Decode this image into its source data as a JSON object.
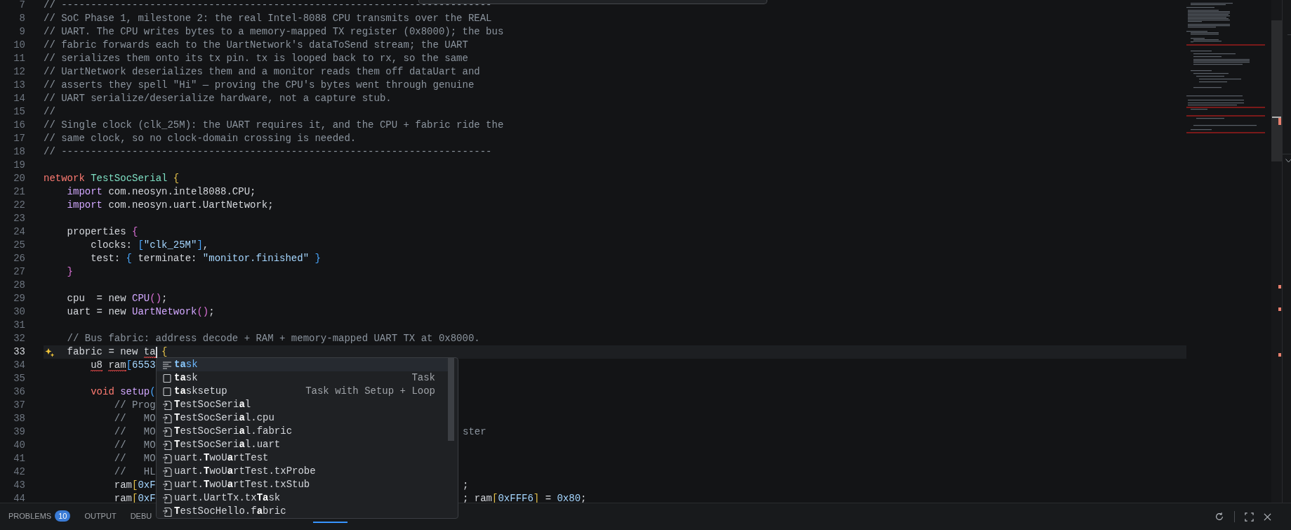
{
  "editor": {
    "lines": [
      {
        "number": "7",
        "tokens": [
          {
            "kind": "comment",
            "text": "// -------------------------------------------------------------------------"
          }
        ]
      },
      {
        "number": "8",
        "tokens": [
          {
            "kind": "comment",
            "text": "// SoC Phase 1, milestone 2: the real Intel-8088 CPU transmits over the REAL"
          }
        ]
      },
      {
        "number": "9",
        "tokens": [
          {
            "kind": "comment",
            "text": "// UART. The CPU writes bytes to a memory-mapped TX register (0x8000); the bus"
          }
        ]
      },
      {
        "number": "10",
        "tokens": [
          {
            "kind": "comment",
            "text": "// fabric forwards each to the UartNetwork's dataToSend stream; the UART"
          }
        ]
      },
      {
        "number": "11",
        "tokens": [
          {
            "kind": "comment",
            "text": "// serializes them onto its tx pin. tx is looped back to rx, so the same"
          }
        ]
      },
      {
        "number": "12",
        "tokens": [
          {
            "kind": "comment",
            "text": "// UartNetwork deserializes them and a monitor reads them off dataUart and"
          }
        ]
      },
      {
        "number": "13",
        "tokens": [
          {
            "kind": "comment",
            "text": "// asserts they spell \"Hi\" — proving the CPU's bytes went through genuine"
          }
        ]
      },
      {
        "number": "14",
        "tokens": [
          {
            "kind": "comment",
            "text": "// UART serialize/deserialize hardware, not a capture stub."
          }
        ]
      },
      {
        "number": "15",
        "tokens": [
          {
            "kind": "comment",
            "text": "//"
          }
        ]
      },
      {
        "number": "16",
        "tokens": [
          {
            "kind": "comment",
            "text": "// Single clock (clk_25M): the UART requires it, and the CPU + fabric ride the"
          }
        ]
      },
      {
        "number": "17",
        "tokens": [
          {
            "kind": "comment",
            "text": "// same clock, so no clock-domain crossing is needed."
          }
        ]
      },
      {
        "number": "18",
        "tokens": [
          {
            "kind": "comment",
            "text": "// -------------------------------------------------------------------------"
          }
        ]
      },
      {
        "number": "19"
      },
      {
        "number": "20",
        "tokens": [
          {
            "kind": "keyword",
            "text": "network "
          },
          {
            "kind": "type",
            "text": "TestSocSerial "
          },
          {
            "kind": "bracket1",
            "text": "{"
          }
        ]
      },
      {
        "number": "21",
        "tokens": [
          {
            "kind": "import",
            "text": "    import"
          },
          {
            "kind": "plain",
            "text": " com.neosyn.intel8088.CPU;"
          }
        ]
      },
      {
        "number": "22",
        "tokens": [
          {
            "kind": "import",
            "text": "    import"
          },
          {
            "kind": "plain",
            "text": " com.neosyn.uart.UartNetwork;"
          }
        ]
      },
      {
        "number": "23"
      },
      {
        "number": "24",
        "tokens": [
          {
            "kind": "plain",
            "text": "    properties "
          },
          {
            "kind": "bracket2",
            "text": "{"
          }
        ]
      },
      {
        "number": "25",
        "tokens": [
          {
            "kind": "plain",
            "text": "        clocks: "
          },
          {
            "kind": "bracket3",
            "text": "["
          },
          {
            "kind": "string",
            "text": "\"clk_25M\""
          },
          {
            "kind": "bracket3",
            "text": "]"
          },
          {
            "kind": "plain",
            "text": ","
          }
        ]
      },
      {
        "number": "26",
        "tokens": [
          {
            "kind": "plain",
            "text": "        test: "
          },
          {
            "kind": "bracket3",
            "text": "{"
          },
          {
            "kind": "plain",
            "text": " terminate: "
          },
          {
            "kind": "string",
            "text": "\"monitor.finished\" "
          },
          {
            "kind": "bracket3",
            "text": "}"
          }
        ]
      },
      {
        "number": "27",
        "tokens": [
          {
            "kind": "bracket2",
            "text": "    }"
          }
        ]
      },
      {
        "number": "28"
      },
      {
        "number": "29",
        "tokens": [
          {
            "kind": "plain",
            "text": "    cpu  = new "
          },
          {
            "kind": "call",
            "text": "CPU"
          },
          {
            "kind": "bracket2",
            "text": "()"
          },
          {
            "kind": "plain",
            "text": ";"
          }
        ]
      },
      {
        "number": "30",
        "tokens": [
          {
            "kind": "plain",
            "text": "    uart = new "
          },
          {
            "kind": "call",
            "text": "UartNetwork"
          },
          {
            "kind": "bracket2",
            "text": "()"
          },
          {
            "kind": "plain",
            "text": ";"
          }
        ]
      },
      {
        "number": "31"
      },
      {
        "number": "32",
        "tokens": [
          {
            "kind": "comment",
            "text": "    // Bus fabric: address decode + RAM + memory-mapped UART TX at 0x8000."
          }
        ]
      },
      {
        "number": "33",
        "current": true,
        "hint": true,
        "tokens": [
          {
            "kind": "plain",
            "text": "    fabric = new "
          },
          {
            "kind": "plain",
            "text": "ta",
            "error": true,
            "cursor": true
          },
          {
            "kind": "bracket1",
            "text": " {"
          }
        ]
      },
      {
        "number": "34",
        "tokens": [
          {
            "kind": "plain",
            "text": "        u8 ",
            "error": true
          },
          {
            "kind": "plain",
            "text": "ram",
            "error": true
          },
          {
            "kind": "bracket3",
            "text": "["
          },
          {
            "kind": "number",
            "text": "6553"
          }
        ]
      },
      {
        "number": "35"
      },
      {
        "number": "36",
        "tokens": [
          {
            "kind": "keyword",
            "text": "        void "
          },
          {
            "kind": "call",
            "text": "setup"
          },
          {
            "kind": "bracket3",
            "text": "("
          }
        ]
      },
      {
        "number": "37",
        "tokens": [
          {
            "kind": "comment",
            "text": "            // Prog"
          }
        ]
      },
      {
        "number": "38",
        "tokens": [
          {
            "kind": "comment",
            "text": "            //   MO"
          }
        ]
      },
      {
        "number": "39",
        "tokens": [
          {
            "kind": "comment",
            "text": "            //   MO"
          }
        ],
        "tail": [
          {
            "kind": "comment",
            "text": "ster"
          }
        ]
      },
      {
        "number": "40",
        "tokens": [
          {
            "kind": "comment",
            "text": "            //   MO"
          }
        ]
      },
      {
        "number": "41",
        "tokens": [
          {
            "kind": "comment",
            "text": "            //   MO"
          }
        ]
      },
      {
        "number": "42",
        "tokens": [
          {
            "kind": "comment",
            "text": "            //   HL"
          }
        ]
      },
      {
        "number": "43",
        "tokens": [
          {
            "kind": "plain",
            "text": "            ram"
          },
          {
            "kind": "bracket1",
            "text": "["
          },
          {
            "kind": "number",
            "text": "0xF"
          }
        ],
        "tail": [
          {
            "kind": "plain",
            "text": ";"
          }
        ]
      },
      {
        "number": "44",
        "tokens": [
          {
            "kind": "plain",
            "text": "            ram"
          },
          {
            "kind": "bracket1",
            "text": "["
          },
          {
            "kind": "number",
            "text": "0xF"
          }
        ],
        "tail": [
          {
            "kind": "plain",
            "text": "; ram"
          },
          {
            "kind": "bracket1",
            "text": "["
          },
          {
            "kind": "number",
            "text": "0xFFF6"
          },
          {
            "kind": "bracket1",
            "text": "]"
          },
          {
            "kind": "plain",
            "text": " = "
          },
          {
            "kind": "number",
            "text": "0x80"
          },
          {
            "kind": "plain",
            "text": ";"
          }
        ]
      }
    ]
  },
  "suggestions": [
    {
      "kind": "snippet",
      "label": "**ta**sk",
      "selected": true
    },
    {
      "kind": "keyword",
      "label": "**ta**sk",
      "detail": "Task",
      "selected": false
    },
    {
      "kind": "keyword",
      "label": "**ta**sksetup",
      "detail": "Task with Setup + Loop",
      "selected": false
    },
    {
      "kind": "reference",
      "label": "**T**estSocSeri**a**l",
      "selected": false
    },
    {
      "kind": "reference",
      "label": "**T**estSocSeri**a**l.cpu",
      "selected": false
    },
    {
      "kind": "reference",
      "label": "**T**estSocSeri**a**l.fabric",
      "selected": false
    },
    {
      "kind": "reference",
      "label": "**T**estSocSeri**a**l.uart",
      "selected": false
    },
    {
      "kind": "reference",
      "label": "uart.**T**woU**a**rtTest",
      "selected": false
    },
    {
      "kind": "reference",
      "label": "uart.**T**woU**a**rtTest.txProbe",
      "selected": false
    },
    {
      "kind": "reference",
      "label": "uart.**T**woU**a**rtTest.txStub",
      "selected": false
    },
    {
      "kind": "reference",
      "label": "uart.UartTx.tx**Ta**sk",
      "selected": false
    },
    {
      "kind": "reference",
      "label": "**T**estSocHello.f**a**bric",
      "selected": false
    }
  ],
  "panel": {
    "tabs": [
      {
        "label": "PROBLEMS",
        "badge": "10",
        "selected": false
      },
      {
        "label": "OUTPUT",
        "selected": false
      },
      {
        "label": "DEBU",
        "selected": false
      }
    ]
  }
}
